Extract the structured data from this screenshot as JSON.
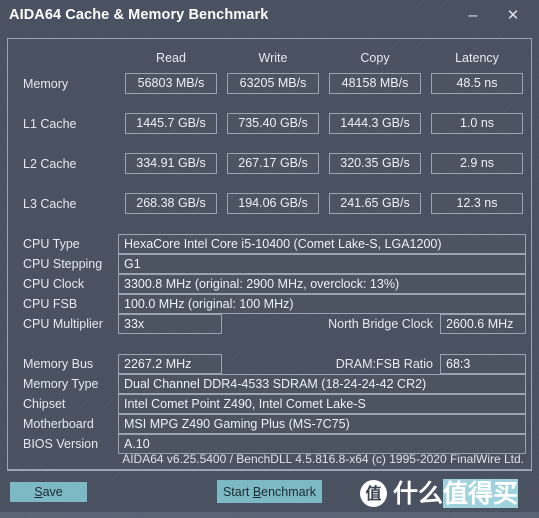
{
  "window": {
    "title": "AIDA64 Cache & Memory Benchmark",
    "minimize_glyph": "–",
    "close_glyph": "✕"
  },
  "benchmark": {
    "columns": [
      "Read",
      "Write",
      "Copy",
      "Latency"
    ],
    "rows": [
      {
        "label": "Memory",
        "read": "56803 MB/s",
        "write": "63205 MB/s",
        "copy": "48158 MB/s",
        "latency": "48.5 ns"
      },
      {
        "label": "L1 Cache",
        "read": "1445.7 GB/s",
        "write": "735.40 GB/s",
        "copy": "1444.3 GB/s",
        "latency": "1.0 ns"
      },
      {
        "label": "L2 Cache",
        "read": "334.91 GB/s",
        "write": "267.17 GB/s",
        "copy": "320.35 GB/s",
        "latency": "2.9 ns"
      },
      {
        "label": "L3 Cache",
        "read": "268.38 GB/s",
        "write": "194.06 GB/s",
        "copy": "241.65 GB/s",
        "latency": "12.3 ns"
      }
    ]
  },
  "cpu_info": {
    "cpu_type_label": "CPU Type",
    "cpu_type_value": "HexaCore Intel Core i5-10400  (Comet Lake-S, LGA1200)",
    "cpu_stepping_label": "CPU Stepping",
    "cpu_stepping_value": "G1",
    "cpu_clock_label": "CPU Clock",
    "cpu_clock_value": "3300.8 MHz  (original: 2900 MHz, overclock: 13%)",
    "cpu_fsb_label": "CPU FSB",
    "cpu_fsb_value": "100.0 MHz  (original: 100 MHz)",
    "cpu_multiplier_label": "CPU Multiplier",
    "cpu_multiplier_value": "33x",
    "north_bridge_label": "North Bridge Clock",
    "north_bridge_value": "2600.6 MHz"
  },
  "memory_info": {
    "memory_bus_label": "Memory Bus",
    "memory_bus_value": "2267.2 MHz",
    "dram_fsb_label": "DRAM:FSB Ratio",
    "dram_fsb_value": "68:3",
    "memory_type_label": "Memory Type",
    "memory_type_value": "Dual Channel DDR4-4533 SDRAM  (18-24-24-42 CR2)",
    "chipset_label": "Chipset",
    "chipset_value": "Intel Comet Point Z490, Intel Comet Lake-S",
    "motherboard_label": "Motherboard",
    "motherboard_value": "MSI MPG Z490 Gaming Plus (MS-7C75)",
    "bios_label": "BIOS Version",
    "bios_value": "A.10"
  },
  "footer": {
    "version_text": "AIDA64 v6.25.5400 / BenchDLL 4.5.816.8-x64  (c) 1995-2020 FinalWire Ltd.",
    "save_label": "Save",
    "save_accel": "S",
    "save_rest": "ave",
    "start_label": "Start Benchmark",
    "start_pre": "Start ",
    "start_accel": "B",
    "start_rest": "enchmark"
  },
  "watermark": {
    "badge_char": "值",
    "text_plain": "什么",
    "text_highlight": "值得买"
  },
  "colors": {
    "window_bg": "#4a5160",
    "border": "#9aa3b0",
    "button": "#7cb9c4",
    "text": "#e8eaee",
    "bottom_strip": "#5a6475"
  }
}
